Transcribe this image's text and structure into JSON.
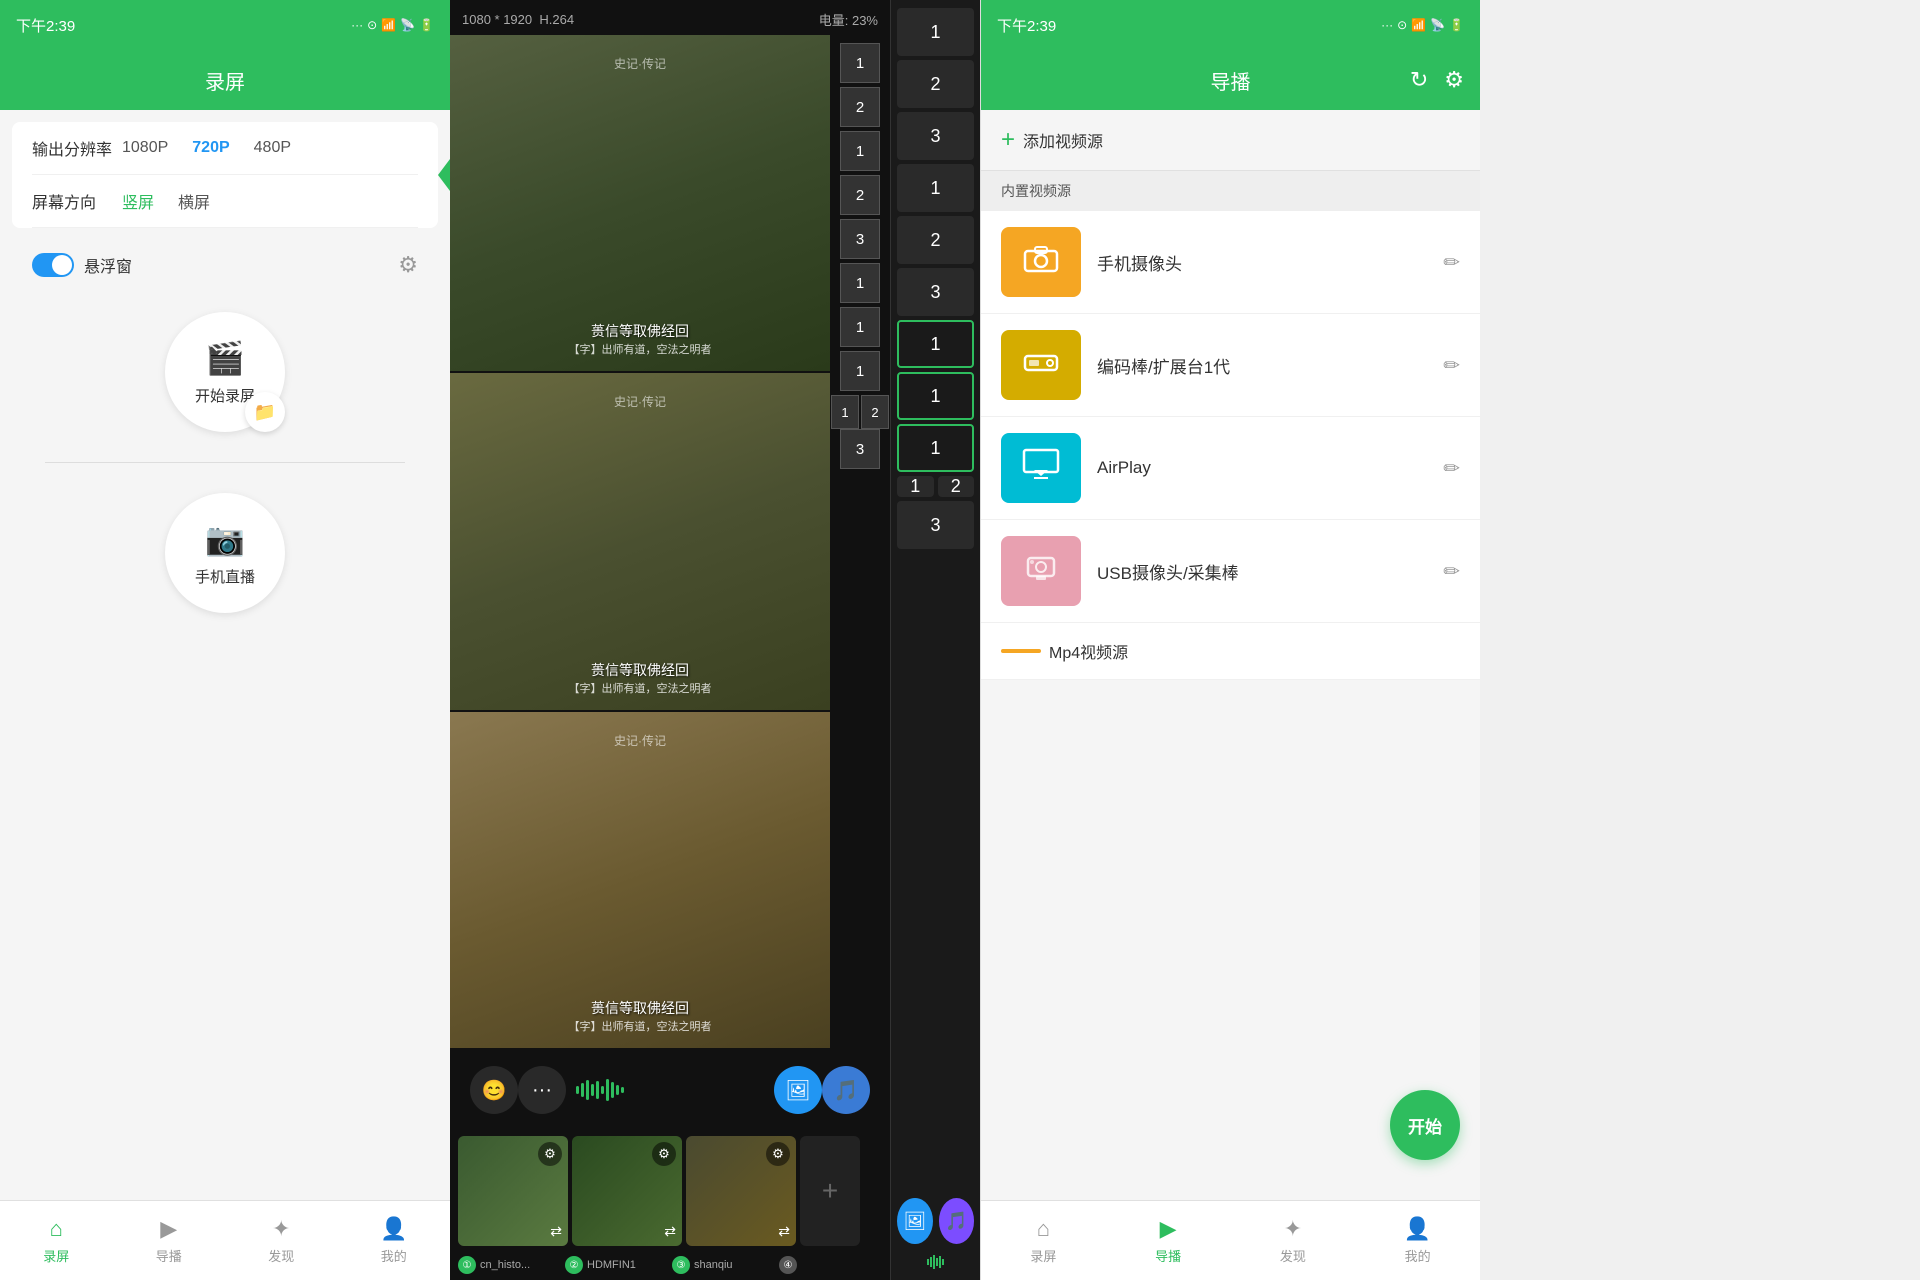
{
  "panel1": {
    "title": "录屏",
    "statusBar": {
      "time": "下午2:39"
    },
    "settings": {
      "resolutionLabel": "输出分辨率",
      "options": [
        "1080P",
        "720P",
        "480P"
      ],
      "selectedResolution": "720P",
      "orientationLabel": "屏幕方向",
      "orientationOptions": [
        "竖屏",
        "横屏"
      ],
      "selectedOrientation": "竖屏"
    },
    "floatWindow": {
      "label": "悬浮窗"
    },
    "buttons": {
      "startRecord": "开始录屏",
      "phoneLive": "手机直播"
    },
    "bottomNav": [
      {
        "label": "录屏",
        "active": true
      },
      {
        "label": "导播",
        "active": false
      },
      {
        "label": "发现",
        "active": false
      },
      {
        "label": "我的",
        "active": false
      }
    ]
  },
  "panel2": {
    "topbar": {
      "resolution": "1080 * 1920",
      "codec": "H.264",
      "battery": "电量: 23%"
    },
    "videoText": "蒉信等取佛经回",
    "videoSub": "【字】出师有道，空法之明者",
    "toolbar": {
      "numbers": [
        "1",
        "2",
        "1",
        "2",
        "3",
        "1",
        "1",
        "1",
        "1",
        "2",
        "3"
      ]
    },
    "thumbnails": [
      {
        "id": "1",
        "label": "cn_histo...",
        "num": "1"
      },
      {
        "id": "2",
        "label": "HDMFIN1",
        "num": "2"
      },
      {
        "id": "3",
        "label": "shanqiu",
        "num": "3"
      },
      {
        "id": "4",
        "label": "",
        "num": "4"
      }
    ]
  },
  "panel3": {
    "numbers": [
      "1",
      "2",
      "3",
      "1",
      "1",
      "1",
      "1",
      "2",
      "3"
    ]
  },
  "panel4": {
    "title": "导播",
    "statusBar": {
      "time": "下午2:39"
    },
    "addSource": "添加视频源",
    "builtinLabel": "内置视频源",
    "sources": [
      {
        "name": "手机摄像头",
        "color": "orange",
        "icon": "📷"
      },
      {
        "name": "编码棒/扩展台1代",
        "color": "yellow",
        "icon": "💾"
      },
      {
        "name": "AirPlay",
        "color": "teal",
        "icon": "📺"
      },
      {
        "name": "USB摄像头/采集棒",
        "color": "pink",
        "icon": "📷"
      }
    ],
    "mp4Source": "Mp4视频源",
    "startBtn": "开始",
    "bottomNav": [
      {
        "label": "录屏",
        "active": false
      },
      {
        "label": "导播",
        "active": true
      },
      {
        "label": "发现",
        "active": false
      },
      {
        "label": "我的",
        "active": false
      }
    ]
  }
}
